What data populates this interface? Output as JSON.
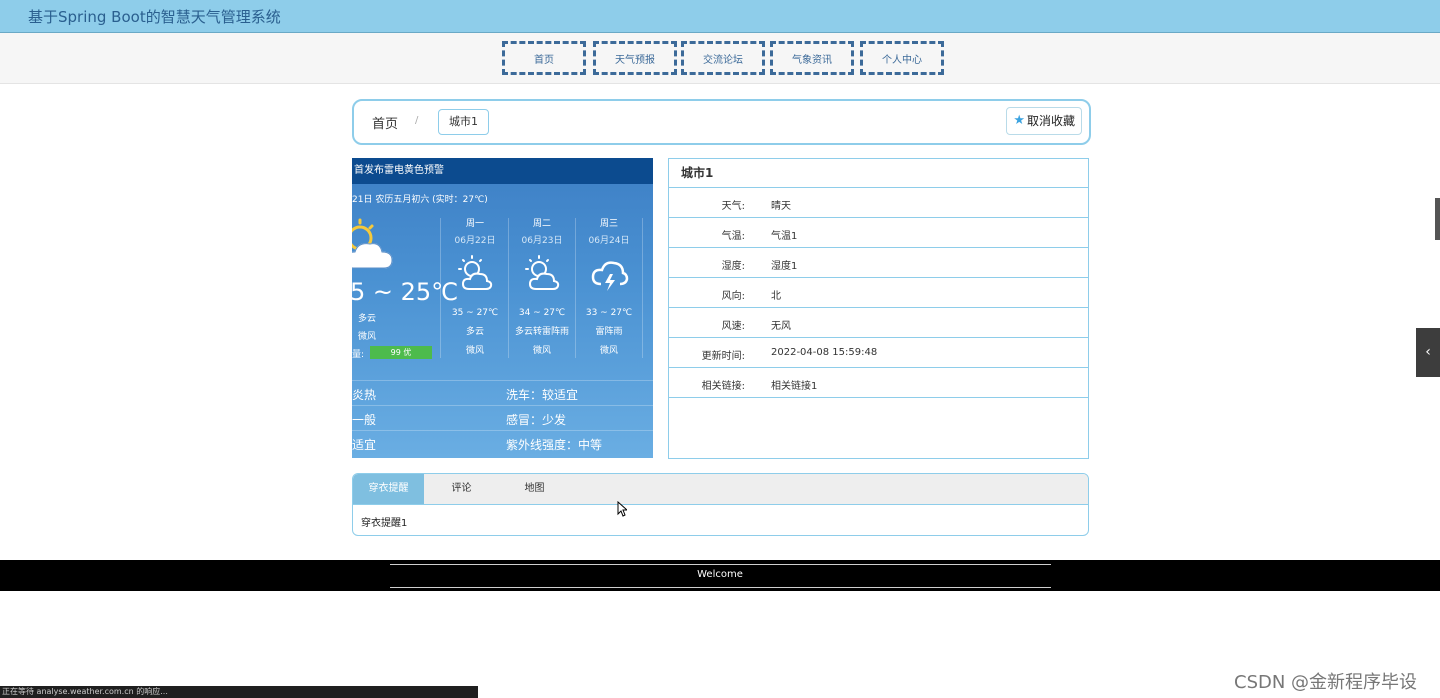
{
  "app": {
    "title": "基于Spring Boot的智慧天气管理系统"
  },
  "nav": {
    "items": [
      "首页",
      "天气预报",
      "交流论坛",
      "气象资讯",
      "个人中心"
    ]
  },
  "breadcrumb": {
    "home": "首页",
    "separator": "/",
    "current": "城市1"
  },
  "favorite": {
    "label": "取消收藏",
    "icon": "star-icon"
  },
  "weather_image": {
    "alert": "首发布雷电黄色预警",
    "date": "21日 农历五月初六 (实时：27℃)",
    "current": {
      "temp": "5 ~ 25℃",
      "cond": "多云",
      "wind": "微风",
      "aqi_label": "量:",
      "aqi": "99 优"
    },
    "days": [
      {
        "week": "周一",
        "date": "06月22日",
        "temp": "35 ~ 27℃",
        "cond": "多云",
        "wind": "微风",
        "icon": "partly-cloudy-icon"
      },
      {
        "week": "周二",
        "date": "06月23日",
        "temp": "34 ~ 27℃",
        "cond": "多云转雷阵雨",
        "wind": "微风",
        "icon": "partly-cloudy-icon"
      },
      {
        "week": "周三",
        "date": "06月24日",
        "temp": "33 ~ 27℃",
        "cond": "雷阵雨",
        "wind": "微风",
        "icon": "thunderstorm-icon"
      }
    ],
    "indices": [
      "炎热",
      "洗车：较适宜",
      "一般",
      "感冒：少发",
      "适宜",
      "紫外线强度：中等"
    ]
  },
  "info": {
    "title": "城市1",
    "rows": [
      {
        "k": "天气:",
        "v": "晴天"
      },
      {
        "k": "气温:",
        "v": "气温1"
      },
      {
        "k": "湿度:",
        "v": "湿度1"
      },
      {
        "k": "风向:",
        "v": "北"
      },
      {
        "k": "风速:",
        "v": "无风"
      },
      {
        "k": "更新时间:",
        "v": "2022-04-08 15:59:48"
      },
      {
        "k": "相关链接:",
        "v": "相关链接1"
      }
    ]
  },
  "tabs": {
    "items": [
      "穿衣提醒",
      "评论",
      "地图"
    ],
    "active": 0,
    "content": "穿衣提醒1"
  },
  "footer": {
    "text": "Welcome"
  },
  "status_bar": {
    "text": "正在等待 analyse.weather.com.cn 的响应..."
  },
  "watermark": {
    "text": "CSDN @金新程序毕设"
  },
  "colors": {
    "topbar": "#8ecdea",
    "accent": "#3c6a99",
    "border": "#8ecdea",
    "tab_active": "#7fbfe0"
  }
}
